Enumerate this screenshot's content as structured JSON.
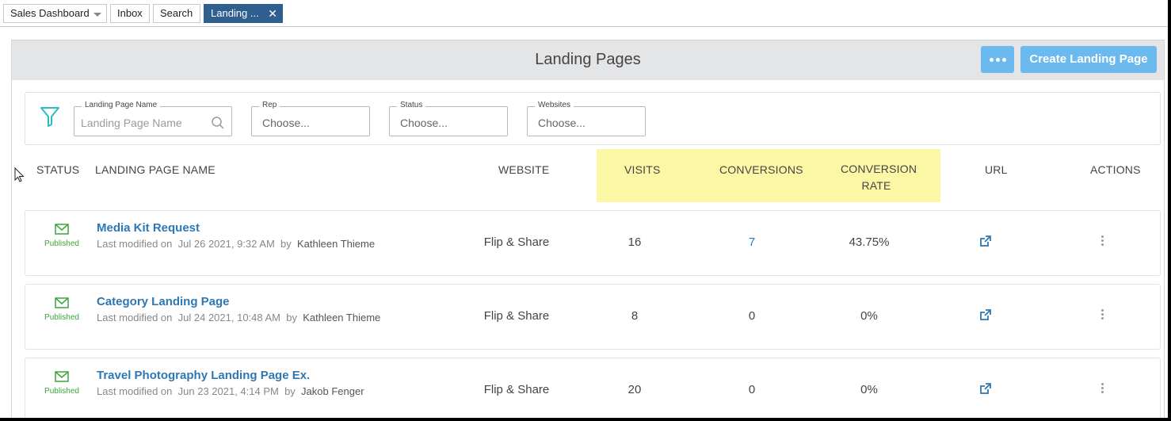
{
  "tabs": [
    {
      "label": "Sales Dashboard"
    },
    {
      "label": "Inbox"
    },
    {
      "label": "Search"
    },
    {
      "label": "Landing ..."
    }
  ],
  "page": {
    "title": "Landing Pages",
    "create_button": "Create Landing Page"
  },
  "filters": {
    "name": {
      "label": "Landing Page Name",
      "placeholder": "Landing Page Name"
    },
    "rep": {
      "label": "Rep",
      "value": "Choose..."
    },
    "status": {
      "label": "Status",
      "value": "Choose..."
    },
    "websites": {
      "label": "Websites",
      "value": "Choose..."
    }
  },
  "columns": {
    "status": "STATUS",
    "name": "LANDING PAGE NAME",
    "website": "WEBSITE",
    "visits": "VISITS",
    "conversions": "CONVERSIONS",
    "conversion_rate_1": "CONVERSION",
    "conversion_rate_2": "RATE",
    "url": "URL",
    "actions": "ACTIONS"
  },
  "rows": [
    {
      "status": "Published",
      "name": "Media Kit Request",
      "modified_prefix": "Last modified on",
      "date": "Jul 26 2021, 9:32 AM",
      "by": "by",
      "author": "Kathleen Thieme",
      "website": "Flip & Share",
      "visits": "16",
      "conversions": "7",
      "rate": "43.75%"
    },
    {
      "status": "Published",
      "name": "Category Landing Page",
      "modified_prefix": "Last modified on",
      "date": "Jul 24 2021, 10:48 AM",
      "by": "by",
      "author": "Kathleen Thieme",
      "website": "Flip & Share",
      "visits": "8",
      "conversions": "0",
      "rate": "0%"
    },
    {
      "status": "Published",
      "name": "Travel Photography Landing Page Ex.",
      "modified_prefix": "Last modified on",
      "date": "Jun 23 2021, 4:14 PM",
      "by": "by",
      "author": "Jakob Fenger",
      "website": "Flip & Share",
      "visits": "20",
      "conversions": "0",
      "rate": "0%"
    }
  ],
  "colors": {
    "accent": "#6bb9ef",
    "active_tab": "#2e5f8f",
    "link": "#2d78b4",
    "highlight": "#fcf7a5",
    "published": "#3aa53a"
  },
  "icons": [
    "caret-down-icon",
    "close-icon",
    "more-horizontal-icon",
    "filter-icon",
    "search-icon",
    "envelope-icon",
    "external-link-icon",
    "kebab-menu-icon",
    "mouse-cursor-icon"
  ]
}
